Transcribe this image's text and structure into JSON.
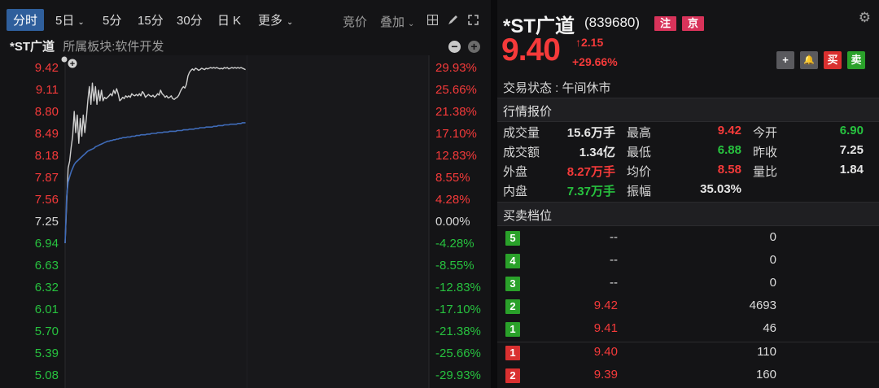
{
  "toolbar": {
    "tabs": [
      "分时",
      "5日",
      "5分",
      "15分",
      "30分",
      "日 K",
      "更多"
    ],
    "right_items": [
      "竞价",
      "叠加"
    ]
  },
  "info": {
    "name": "*ST广道",
    "sector": "所属板块:软件开发"
  },
  "chart_data": {
    "type": "line",
    "y_left_ticks": [
      "9.42",
      "9.11",
      "8.80",
      "8.49",
      "8.18",
      "7.87",
      "7.56",
      "7.25",
      "6.94",
      "6.63",
      "6.32",
      "6.01",
      "5.70",
      "5.39",
      "5.08"
    ],
    "y_right_ticks": [
      "29.93%",
      "25.66%",
      "21.38%",
      "17.10%",
      "12.83%",
      "8.55%",
      "4.28%",
      "0.00%",
      "-4.28%",
      "-8.55%",
      "-12.83%",
      "-17.10%",
      "-21.38%",
      "-25.66%",
      "-29.93%"
    ],
    "prev_close": 7.25,
    "ylim": [
      5.08,
      9.42
    ],
    "x_sessions": 240,
    "x_max_shown": 120,
    "series": [
      {
        "color": "#cfcfcf",
        "values": [
          6.94,
          7.5,
          8.0,
          8.1,
          8.3,
          8.45,
          8.8,
          8.5,
          8.75,
          8.35,
          8.7,
          8.45,
          8.75,
          8.5,
          8.7,
          8.95,
          9.15,
          8.9,
          9.2,
          8.95,
          9.15,
          8.9,
          9.1,
          8.95,
          9.1,
          8.95,
          9.0,
          8.98,
          9.0,
          9.02,
          9.05,
          9.02,
          9.1,
          9.05,
          9.12,
          9.05,
          8.95,
          8.97,
          9.0,
          8.98,
          9.02,
          9.0,
          9.02,
          9.0,
          9.05,
          9.03,
          9.02,
          9.04,
          9.02,
          9.05,
          9.02,
          9.08,
          9.05,
          9.0,
          9.02,
          9.04,
          9.02,
          9.01,
          9.03,
          9.0,
          9.02,
          9.05,
          9.03,
          9.1,
          9.05,
          9.03,
          9.0,
          9.02,
          8.99,
          9.0,
          9.02,
          8.98,
          8.97,
          8.99,
          9.0,
          9.03,
          9.08,
          9.12,
          9.15,
          9.13,
          9.18,
          9.3,
          9.35,
          9.38,
          9.4,
          9.38,
          9.41,
          9.4,
          9.38,
          9.39,
          9.41,
          9.4,
          9.39,
          9.41,
          9.4,
          9.41,
          9.42,
          9.41,
          9.42,
          9.41,
          9.42,
          9.41,
          9.4,
          9.41,
          9.4,
          9.42,
          9.41,
          9.42,
          9.4,
          9.41,
          9.42,
          9.41,
          9.42,
          9.41,
          9.42,
          9.41,
          9.42,
          9.41,
          9.4,
          9.39
        ]
      },
      {
        "color": "#3f6bb8",
        "values": [
          6.94,
          7.6,
          7.8,
          7.88,
          7.95,
          8.0,
          8.05,
          8.08,
          8.1,
          8.12,
          8.14,
          8.16,
          8.18,
          8.2,
          8.22,
          8.24,
          8.25,
          8.26,
          8.27,
          8.28,
          8.3,
          8.31,
          8.32,
          8.33,
          8.34,
          8.35,
          8.36,
          8.37,
          8.38,
          8.38,
          8.39,
          8.39,
          8.4,
          8.4,
          8.41,
          8.41,
          8.42,
          8.42,
          8.43,
          8.43,
          8.43,
          8.44,
          8.44,
          8.44,
          8.45,
          8.45,
          8.45,
          8.46,
          8.46,
          8.46,
          8.47,
          8.47,
          8.47,
          8.47,
          8.48,
          8.48,
          8.48,
          8.49,
          8.49,
          8.49,
          8.49,
          8.5,
          8.5,
          8.5,
          8.5,
          8.51,
          8.51,
          8.51,
          8.51,
          8.52,
          8.52,
          8.52,
          8.52,
          8.52,
          8.53,
          8.53,
          8.53,
          8.53,
          8.54,
          8.54,
          8.54,
          8.54,
          8.55,
          8.55,
          8.55,
          8.55,
          8.56,
          8.56,
          8.56,
          8.57,
          8.57,
          8.57,
          8.57,
          8.58,
          8.58,
          8.58,
          8.58,
          8.58,
          8.59,
          8.59,
          8.59,
          8.6,
          8.6,
          8.6,
          8.6,
          8.61,
          8.61,
          8.61,
          8.61,
          8.62,
          8.62,
          8.62,
          8.62,
          8.62,
          8.63,
          8.63,
          8.63,
          8.64,
          8.64,
          8.64
        ]
      }
    ]
  },
  "quote": {
    "name": "*ST广道",
    "code": "(839680)",
    "badges": [
      "注",
      "京"
    ],
    "price": "9.40",
    "change": "2.15",
    "change_pct": "+29.66%",
    "buttons": [
      "+",
      "🔔",
      "买",
      "卖"
    ],
    "status": "交易状态 : 午间休市",
    "section_quote": "行情报价",
    "rows": [
      [
        {
          "label": "成交量",
          "value": "15.6万手",
          "color": "#e6e6e6"
        },
        {
          "label": "最高",
          "value": "9.42",
          "color": "#f53a3a"
        },
        {
          "label": "今开",
          "value": "6.90",
          "color": "#27c23f"
        }
      ],
      [
        {
          "label": "成交额",
          "value": "1.34亿",
          "color": "#e6e6e6"
        },
        {
          "label": "最低",
          "value": "6.88",
          "color": "#27c23f"
        },
        {
          "label": "昨收",
          "value": "7.25",
          "color": "#e6e6e6"
        }
      ],
      [
        {
          "label": "外盘",
          "value": "8.27万手",
          "color": "#f53a3a"
        },
        {
          "label": "均价",
          "value": "8.58",
          "color": "#f53a3a"
        },
        {
          "label": "量比",
          "value": "1.84",
          "color": "#e6e6e6"
        }
      ],
      [
        {
          "label": "内盘",
          "value": "7.37万手",
          "color": "#27c23f"
        },
        {
          "label": "振幅",
          "value": "35.03%",
          "color": "#e6e6e6"
        },
        {
          "label": "",
          "value": "",
          "color": "#e6e6e6"
        }
      ]
    ],
    "section_book": "买卖档位",
    "asks": [
      {
        "level": "5",
        "price": "--",
        "vol": "0"
      },
      {
        "level": "4",
        "price": "--",
        "vol": "0"
      },
      {
        "level": "3",
        "price": "--",
        "vol": "0"
      },
      {
        "level": "2",
        "price": "9.42",
        "vol": "4693"
      },
      {
        "level": "1",
        "price": "9.41",
        "vol": "46"
      }
    ],
    "bids": [
      {
        "level": "1",
        "price": "9.40",
        "vol": "110"
      },
      {
        "level": "2",
        "price": "9.39",
        "vol": "160"
      }
    ]
  },
  "colors": {
    "up": "#f53a3a",
    "down": "#27c23f",
    "neutral": "#e6e6e6",
    "ask_badge": "#2aa12a",
    "bid_badge": "#d93030",
    "accent": "#2f5f9c"
  }
}
